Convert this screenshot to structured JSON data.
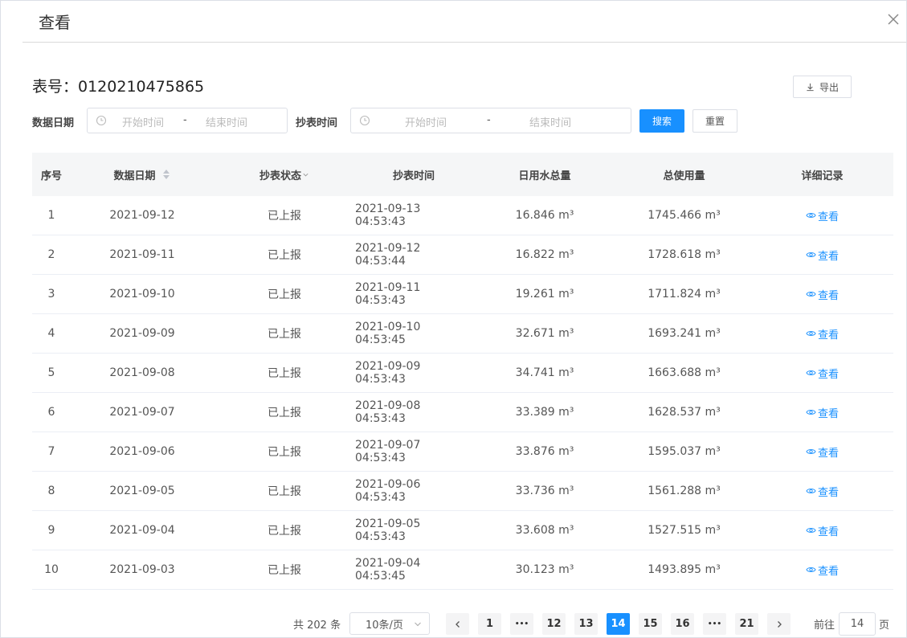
{
  "dialog": {
    "title": "查看"
  },
  "meter": {
    "title": "表号：0120210475865"
  },
  "toolbar": {
    "export_label": "导出"
  },
  "filters": {
    "data_date_label": "数据日期",
    "data_date_start_placeholder": "开始时间",
    "data_date_end_placeholder": "结束时间",
    "read_time_label": "抄表时间",
    "read_time_start_placeholder": "开始时间",
    "read_time_end_placeholder": "结束时间",
    "separator": "-",
    "search_label": "搜索",
    "reset_label": "重置"
  },
  "table": {
    "headers": [
      "序号",
      "数据日期",
      "抄表状态",
      "抄表时间",
      "日用水总量",
      "总使用量",
      "详细记录"
    ],
    "view_label": "查看",
    "rows": [
      [
        "1",
        "2021-09-12",
        "已上报",
        "2021-09-13 04:53:43",
        "16.846 m³",
        "1745.466 m³"
      ],
      [
        "2",
        "2021-09-11",
        "已上报",
        "2021-09-12 04:53:44",
        "16.822 m³",
        "1728.618 m³"
      ],
      [
        "3",
        "2021-09-10",
        "已上报",
        "2021-09-11 04:53:43",
        "19.261 m³",
        "1711.824 m³"
      ],
      [
        "4",
        "2021-09-09",
        "已上报",
        "2021-09-10 04:53:45",
        "32.671 m³",
        "1693.241 m³"
      ],
      [
        "5",
        "2021-09-08",
        "已上报",
        "2021-09-09 04:53:43",
        "34.741 m³",
        "1663.688 m³"
      ],
      [
        "6",
        "2021-09-07",
        "已上报",
        "2021-09-08 04:53:43",
        "33.389 m³",
        "1628.537 m³"
      ],
      [
        "7",
        "2021-09-06",
        "已上报",
        "2021-09-07 04:53:43",
        "33.876 m³",
        "1595.037 m³"
      ],
      [
        "8",
        "2021-09-05",
        "已上报",
        "2021-09-06 04:53:43",
        "33.736 m³",
        "1561.288 m³"
      ],
      [
        "9",
        "2021-09-04",
        "已上报",
        "2021-09-05 04:53:43",
        "33.608 m³",
        "1527.515 m³"
      ],
      [
        "10",
        "2021-09-03",
        "已上报",
        "2021-09-04 04:53:45",
        "30.123 m³",
        "1493.895 m³"
      ]
    ]
  },
  "pagination": {
    "total_text": "共 202 条",
    "page_size": "10条/页",
    "pages": [
      "1",
      "•••",
      "12",
      "13",
      "14",
      "15",
      "16",
      "•••",
      "21"
    ],
    "current": "14",
    "goto_label": "前往",
    "goto_value": "14",
    "goto_suffix": "页"
  },
  "colors": {
    "primary": "#1890ff",
    "header_bg": "#f5f6f7",
    "border": "#ebeef5"
  }
}
